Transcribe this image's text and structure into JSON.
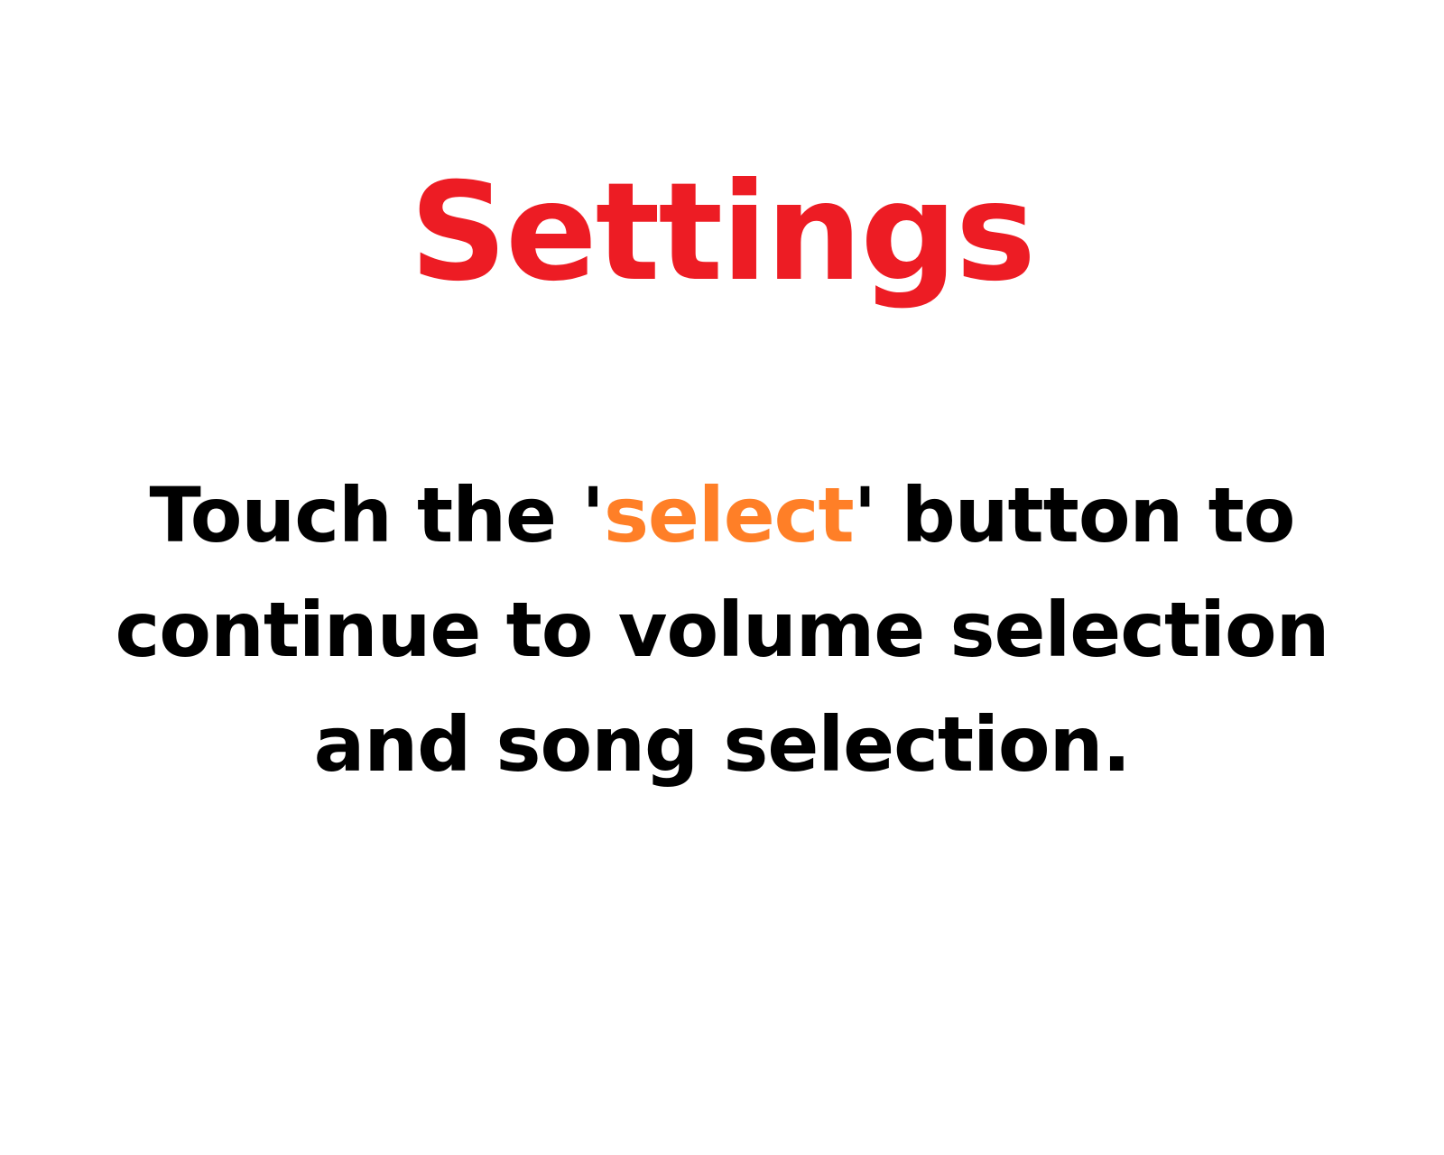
{
  "colors": {
    "title": "#ED1C24",
    "body_text": "#000000",
    "keyword": "#FF7F27",
    "background": "#FFFFFF"
  },
  "screen": {
    "title": "Settings",
    "instructions": {
      "line1_before": "Touch the '",
      "keyword": "select",
      "line1_after": "' button to",
      "line2": "continue to volume selection",
      "line3": "and song selection."
    }
  }
}
